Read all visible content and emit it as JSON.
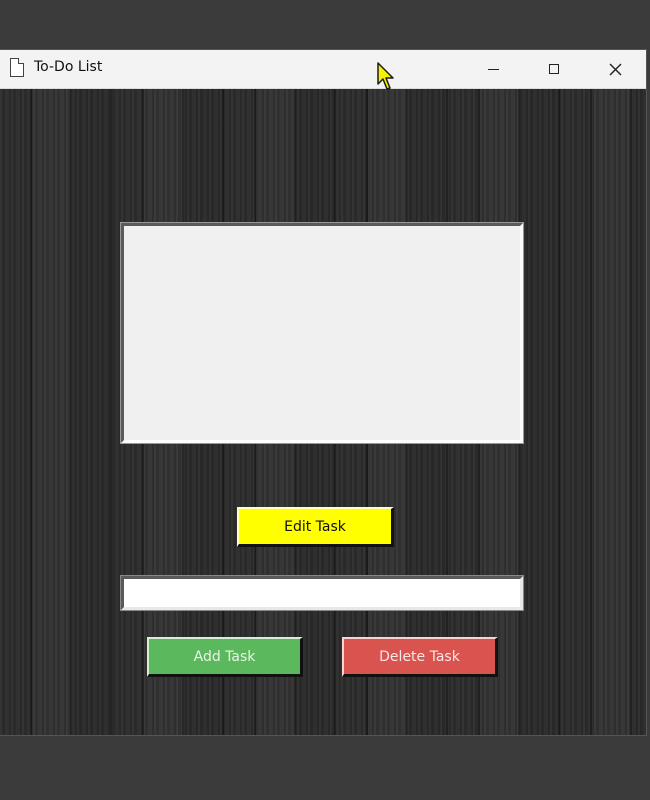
{
  "window": {
    "title": "To-Do List",
    "icon": "document-icon",
    "controls": [
      "minimize-icon",
      "maximize-icon",
      "close-icon"
    ]
  },
  "task_list": {
    "items": []
  },
  "task_entry": {
    "value": ""
  },
  "buttons": {
    "edit_label": "Edit Task",
    "add_label": "Add Task",
    "delete_label": "Delete Task"
  },
  "colors": {
    "edit": "#ffff00",
    "add": "#5cb85c",
    "delete": "#d9534f",
    "background": "#2d2d2d"
  }
}
